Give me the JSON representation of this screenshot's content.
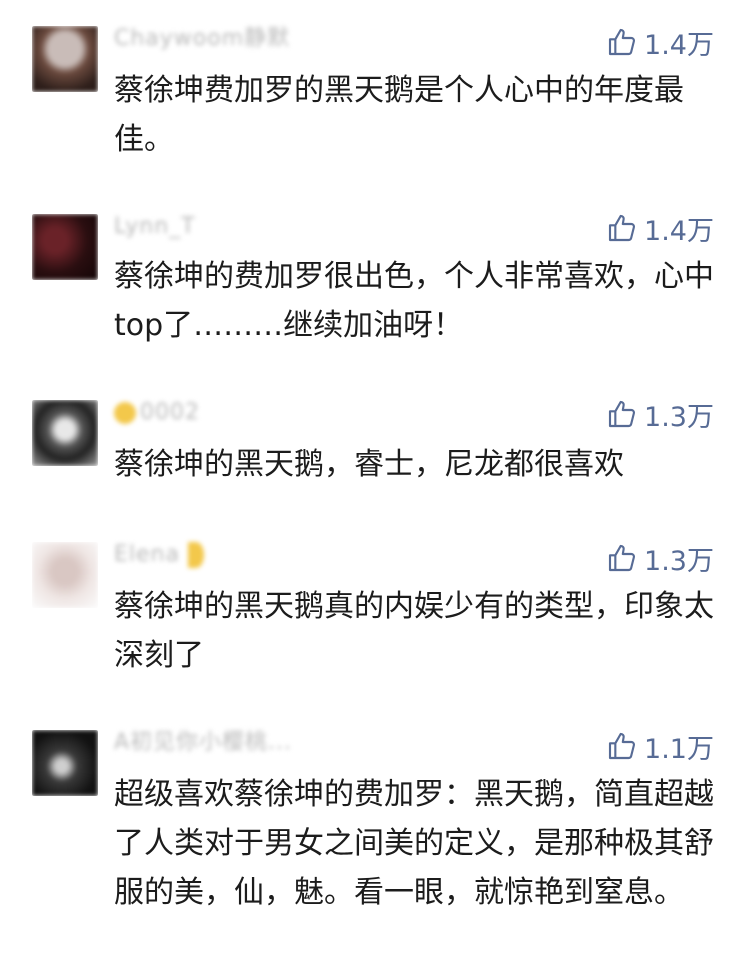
{
  "comments": [
    {
      "username": "Chaywoom静默",
      "likes": "1.4万",
      "text": "蔡徐坤费加罗的黑天鹅是个人心中的年度最佳。",
      "avatar_colors": [
        "#b3a7a5",
        "#6b4a3e",
        "#2d1e1a"
      ]
    },
    {
      "username": "Lynn_T",
      "likes": "1.4万",
      "text": "蔡徐坤的费加罗很出色，个人非常喜欢，心中top了………继续加油呀！",
      "avatar_colors": [
        "#2a0e10",
        "#5a1a20",
        "#150708"
      ]
    },
    {
      "username": "0002",
      "likes": "1.3万",
      "text": "蔡徐坤的黑天鹅，睿士，尼龙都很喜欢",
      "avatar_colors": [
        "#dcdcdc",
        "#333333",
        "#8a8a8a"
      ]
    },
    {
      "username": "Elena",
      "likes": "1.3万",
      "text": "蔡徐坤的黑天鹅真的内娱少有的类型，印象太深刻了",
      "avatar_colors": [
        "#f1e8e6",
        "#d9c7c3",
        "#fafafa"
      ]
    },
    {
      "username": "A初见你小樱桃...",
      "likes": "1.1万",
      "text": "超级喜欢蔡徐坤的费加罗：黑天鹅，简直超越了人类对于男女之间美的定义，是那种极其舒服的美，仙，魅。看一眼，就惊艳到窒息。",
      "avatar_colors": [
        "#1a1a1a",
        "#9a9a9a",
        "#0d0d0d"
      ]
    }
  ],
  "colors": {
    "like": "#576b95",
    "text": "#1c1c1c",
    "username": "#b9b9b9"
  },
  "icons": {
    "like": "thumbs-up-icon"
  }
}
